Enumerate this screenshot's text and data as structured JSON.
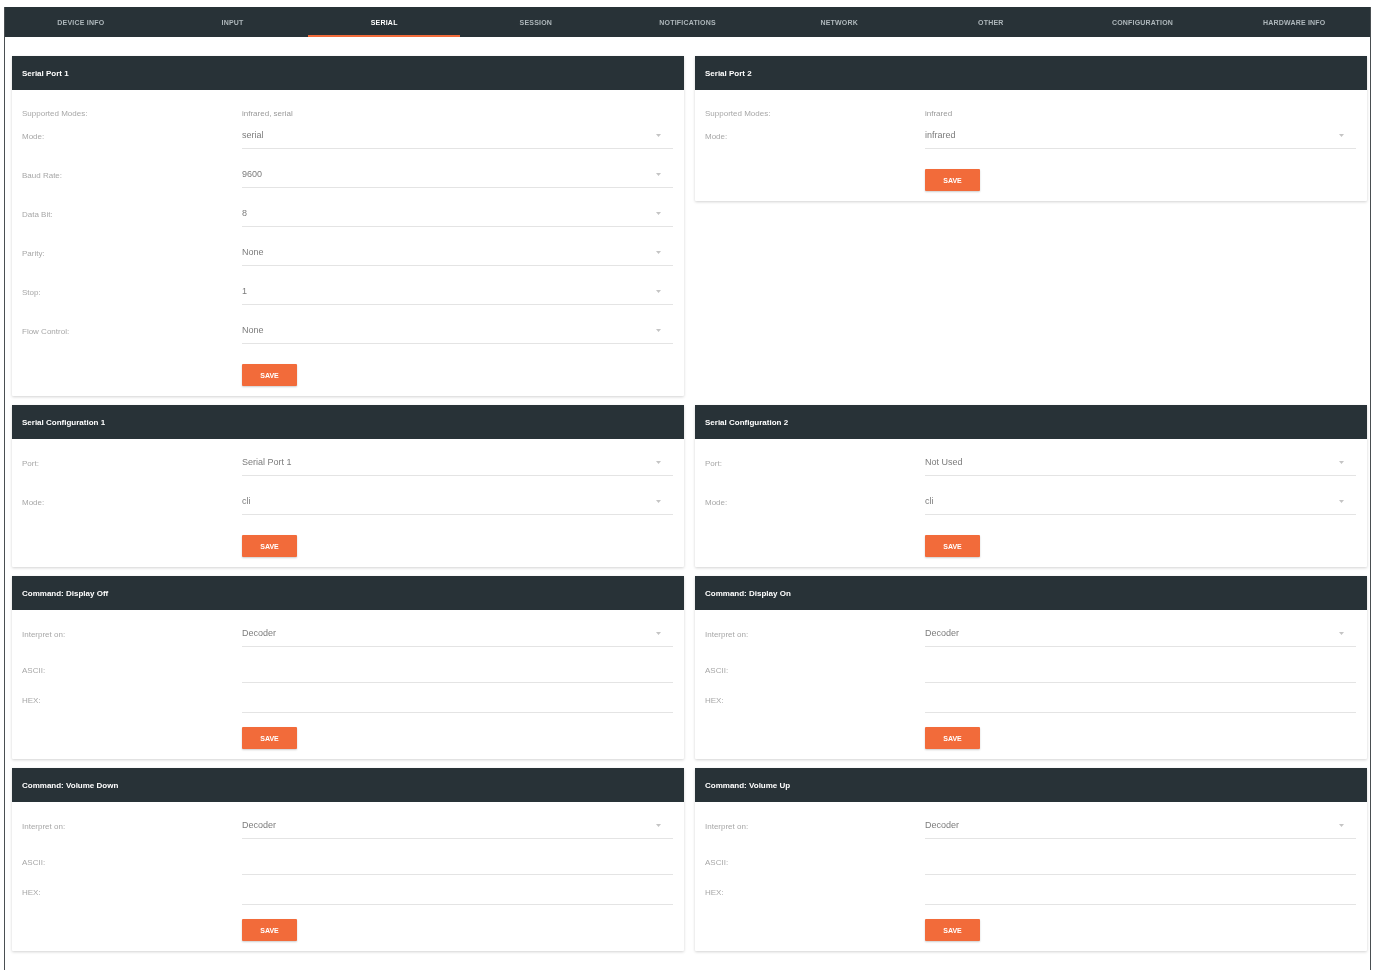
{
  "tabs": [
    {
      "label": "DEVICE INFO",
      "selected": false
    },
    {
      "label": "INPUT",
      "selected": false
    },
    {
      "label": "SERIAL",
      "selected": true
    },
    {
      "label": "SESSION",
      "selected": false
    },
    {
      "label": "NOTIFICATIONS",
      "selected": false
    },
    {
      "label": "NETWORK",
      "selected": false
    },
    {
      "label": "OTHER",
      "selected": false
    },
    {
      "label": "CONFIGURATION",
      "selected": false
    },
    {
      "label": "HARDWARE INFO",
      "selected": false
    }
  ],
  "cards": [
    {
      "title": "Serial Port 1",
      "fields": [
        {
          "kind": "info",
          "label": "Supported Modes:",
          "value": "infrared, serial"
        },
        {
          "kind": "select",
          "label": "Mode:",
          "value": "serial"
        },
        {
          "kind": "select",
          "label": "Baud Rate:",
          "value": "9600"
        },
        {
          "kind": "select",
          "label": "Data Bit:",
          "value": "8"
        },
        {
          "kind": "select",
          "label": "Parity:",
          "value": "None"
        },
        {
          "kind": "select",
          "label": "Stop:",
          "value": "1"
        },
        {
          "kind": "select",
          "label": "Flow Control:",
          "value": "None"
        }
      ],
      "button": "SAVE"
    },
    {
      "title": "Serial Port 2",
      "fields": [
        {
          "kind": "info",
          "label": "Supported Modes:",
          "value": "infrared"
        },
        {
          "kind": "select",
          "label": "Mode:",
          "value": "infrared"
        }
      ],
      "button": "SAVE"
    },
    {
      "title": "Serial Configuration 1",
      "fields": [
        {
          "kind": "select",
          "label": "Port:",
          "value": "Serial Port 1"
        },
        {
          "kind": "select",
          "label": "Mode:",
          "value": "cli"
        }
      ],
      "button": "SAVE"
    },
    {
      "title": "Serial Configuration 2",
      "fields": [
        {
          "kind": "select",
          "label": "Port:",
          "value": "Not Used"
        },
        {
          "kind": "select",
          "label": "Mode:",
          "value": "cli"
        }
      ],
      "button": "SAVE"
    },
    {
      "title": "Command: Display Off",
      "fields": [
        {
          "kind": "select",
          "label": "Interpret on:",
          "value": "Decoder"
        },
        {
          "kind": "text",
          "label": "ASCII:"
        },
        {
          "kind": "text",
          "label": "HEX:"
        }
      ],
      "button": "SAVE"
    },
    {
      "title": "Command: Display On",
      "fields": [
        {
          "kind": "select",
          "label": "Interpret on:",
          "value": "Decoder"
        },
        {
          "kind": "text",
          "label": "ASCII:"
        },
        {
          "kind": "text",
          "label": "HEX:"
        }
      ],
      "button": "SAVE"
    },
    {
      "title": "Command: Volume Down",
      "fields": [
        {
          "kind": "select",
          "label": "Interpret on:",
          "value": "Decoder"
        },
        {
          "kind": "text",
          "label": "ASCII:"
        },
        {
          "kind": "text",
          "label": "HEX:"
        }
      ],
      "button": "SAVE"
    },
    {
      "title": "Command: Volume Up",
      "fields": [
        {
          "kind": "select",
          "label": "Interpret on:",
          "value": "Decoder"
        },
        {
          "kind": "text",
          "label": "ASCII:"
        },
        {
          "kind": "text",
          "label": "HEX:"
        }
      ],
      "button": "SAVE"
    }
  ]
}
